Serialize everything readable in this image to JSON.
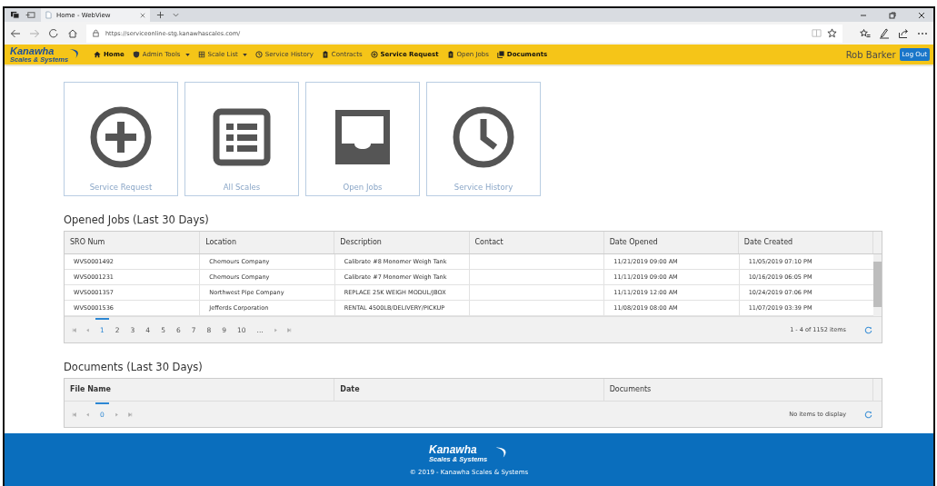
{
  "browser": {
    "tab_title": "Home - WebView",
    "url": "https://serviceonline-stg.kanawhascales.com/"
  },
  "navbar": {
    "logo": {
      "name": "Kanawha",
      "tagline": "Scales & Systems"
    },
    "items": [
      {
        "label": "Home",
        "kind": "home",
        "bold": true,
        "dropdown": false
      },
      {
        "label": "Admin Tools",
        "kind": "shield",
        "bold": false,
        "dropdown": true
      },
      {
        "label": "Scale List",
        "kind": "grid",
        "bold": false,
        "dropdown": true
      },
      {
        "label": "Service History",
        "kind": "clock",
        "bold": false,
        "dropdown": false
      },
      {
        "label": "Contracts",
        "kind": "clipboard",
        "bold": false,
        "dropdown": false
      },
      {
        "label": "Service Request",
        "kind": "plus",
        "bold": true,
        "dropdown": false
      },
      {
        "label": "Open Jobs",
        "kind": "clipboard",
        "bold": false,
        "dropdown": false
      },
      {
        "label": "Documents",
        "kind": "docs",
        "bold": true,
        "dropdown": false
      }
    ],
    "user": "Rob Barker",
    "logout": "Log Out"
  },
  "tiles": [
    {
      "label": "Service Request",
      "kind": "plus"
    },
    {
      "label": "All Scales",
      "kind": "list"
    },
    {
      "label": "Open Jobs",
      "kind": "inbox"
    },
    {
      "label": "Service History",
      "kind": "clock"
    }
  ],
  "opened_jobs": {
    "title": "Opened Jobs (Last 30 Days)",
    "columns": [
      "SRO Num",
      "Location",
      "Description",
      "Contact",
      "Date Opened",
      "Date Created"
    ],
    "rows": [
      [
        "WVS0001492",
        "Chemours Company",
        "Calibrate #8 Monomer Weigh Tank",
        "",
        "11/21/2019 09:00 AM",
        "11/05/2019 07:10 PM"
      ],
      [
        "WVS0001231",
        "Chemours Company",
        "Calibrate #7 Monomer Weigh Tank",
        "",
        "11/11/2019 09:00 AM",
        "10/16/2019 06:05 PM"
      ],
      [
        "WVS0001357",
        "Northwest Pipe Company",
        "REPLACE 25K WEIGH MODUL/JBOX",
        "",
        "11/11/2019 12:00 AM",
        "10/24/2019 07:06 PM"
      ],
      [
        "WVS0001536",
        "Jefferds Corporation",
        "RENTAL 4500LB/DELIVERY/PICKUP",
        "",
        "11/08/2019 08:00 AM",
        "11/07/2019 03:39 PM"
      ]
    ],
    "pages": [
      {
        "label": "1",
        "selected": true
      },
      {
        "label": "2",
        "selected": false
      },
      {
        "label": "3",
        "selected": false
      },
      {
        "label": "4",
        "selected": false
      },
      {
        "label": "5",
        "selected": false
      },
      {
        "label": "6",
        "selected": false
      },
      {
        "label": "7",
        "selected": false
      },
      {
        "label": "8",
        "selected": false
      },
      {
        "label": "9",
        "selected": false
      },
      {
        "label": "10",
        "selected": false
      },
      {
        "label": "...",
        "selected": false
      }
    ],
    "summary": "1 - 4 of 1152 items"
  },
  "documents": {
    "title": "Documents (Last 30 Days)",
    "columns": [
      "File Name",
      "Date",
      "Documents"
    ],
    "pages": [
      {
        "label": "0",
        "selected": true
      }
    ],
    "summary": "No items to display"
  },
  "footer": {
    "logo": {
      "name": "Kanawha",
      "tagline": "Scales & Systems"
    },
    "copyright": "© 2019 - Kanawha Scales & Systems"
  }
}
